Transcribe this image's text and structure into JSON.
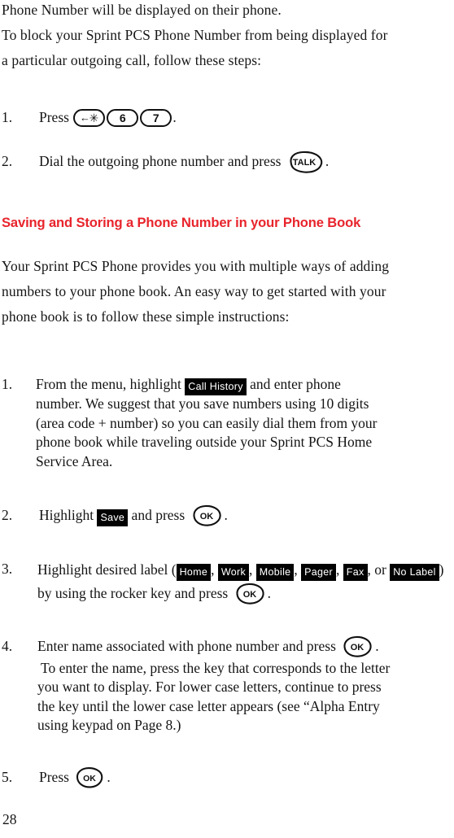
{
  "document": {
    "page_number": "28"
  },
  "intro": {
    "lines": [
      "Phone Number will be displayed on their phone.",
      "To block your Sprint PCS Phone Number from being displayed for",
      "a particular outgoing call, follow these steps:"
    ],
    "full_text": "Phone Number will be displayed on their phone. To block your Sprint PCS Phone Number from being displayed for a particular outgoing call, follow these steps:"
  },
  "top_steps": [
    {
      "number": "1.",
      "text_before": "Press",
      "keys": [
        "star-back-key",
        "6",
        "7"
      ],
      "text_after": "."
    },
    {
      "number": "2.",
      "text_before": "Dial the outgoing phone number and press",
      "keys": [
        "TALK"
      ],
      "text_after": "."
    }
  ],
  "section": {
    "heading": "Saving and Storing a Phone Number in your Phone Book",
    "heading_color": "#e8242c",
    "body": "Your Sprint PCS Phone provides you with multiple ways of adding numbers to your phone book. An easy way to get started with your phone book is to follow these simple instructions:",
    "body_lines": [
      "Your Sprint PCS Phone provides you with multiple ways of adding",
      "numbers to your phone book. An easy way to get started with your",
      "phone book is to follow these simple instructions:"
    ]
  },
  "phonebook_steps": {
    "step1": {
      "number": "1.",
      "text_before": "From the menu, highlight",
      "menu_item": "Call History",
      "text_after": "and enter phone",
      "continuation_lines": [
        "number. We suggest that you save numbers using 10 digits",
        "(area code + number) so you can easily dial them from your",
        "phone book while traveling outside your Sprint PCS Home",
        "Service Area."
      ]
    },
    "step2": {
      "number": "2.",
      "text_before": "Highlight",
      "menu_item": "Save",
      "text_middle": "and press",
      "key": "OK",
      "text_after": "."
    },
    "step3": {
      "number": "3.",
      "text_before": "Highlight desired label (",
      "labels": [
        "Home",
        "Work",
        "Mobile",
        "Pager",
        "Fax",
        "No Label"
      ],
      "text_or": ", or",
      "text_middle": ") by using the rocker key and press",
      "key": "OK",
      "text_after": "."
    },
    "step4": {
      "number": "4.",
      "text_before": "Enter name associated with phone number and press",
      "key": "OK",
      "text_after": ".",
      "continuation_lines": [
        "To enter the name, press the key that corresponds to the letter",
        "you want to display. For lower case letters, continue to press",
        "the key until the lower case letter appears (see “Alpha Entry",
        "using keypad on Page 8.)"
      ]
    },
    "step5": {
      "number": "5.",
      "text_before": "Press",
      "key": "OK",
      "text_after": "."
    }
  },
  "keys": {
    "star_arrow_glyph": "←",
    "star_glyph": "✳",
    "six": "6",
    "seven": "7",
    "talk": "TALK",
    "ok": "OK"
  }
}
